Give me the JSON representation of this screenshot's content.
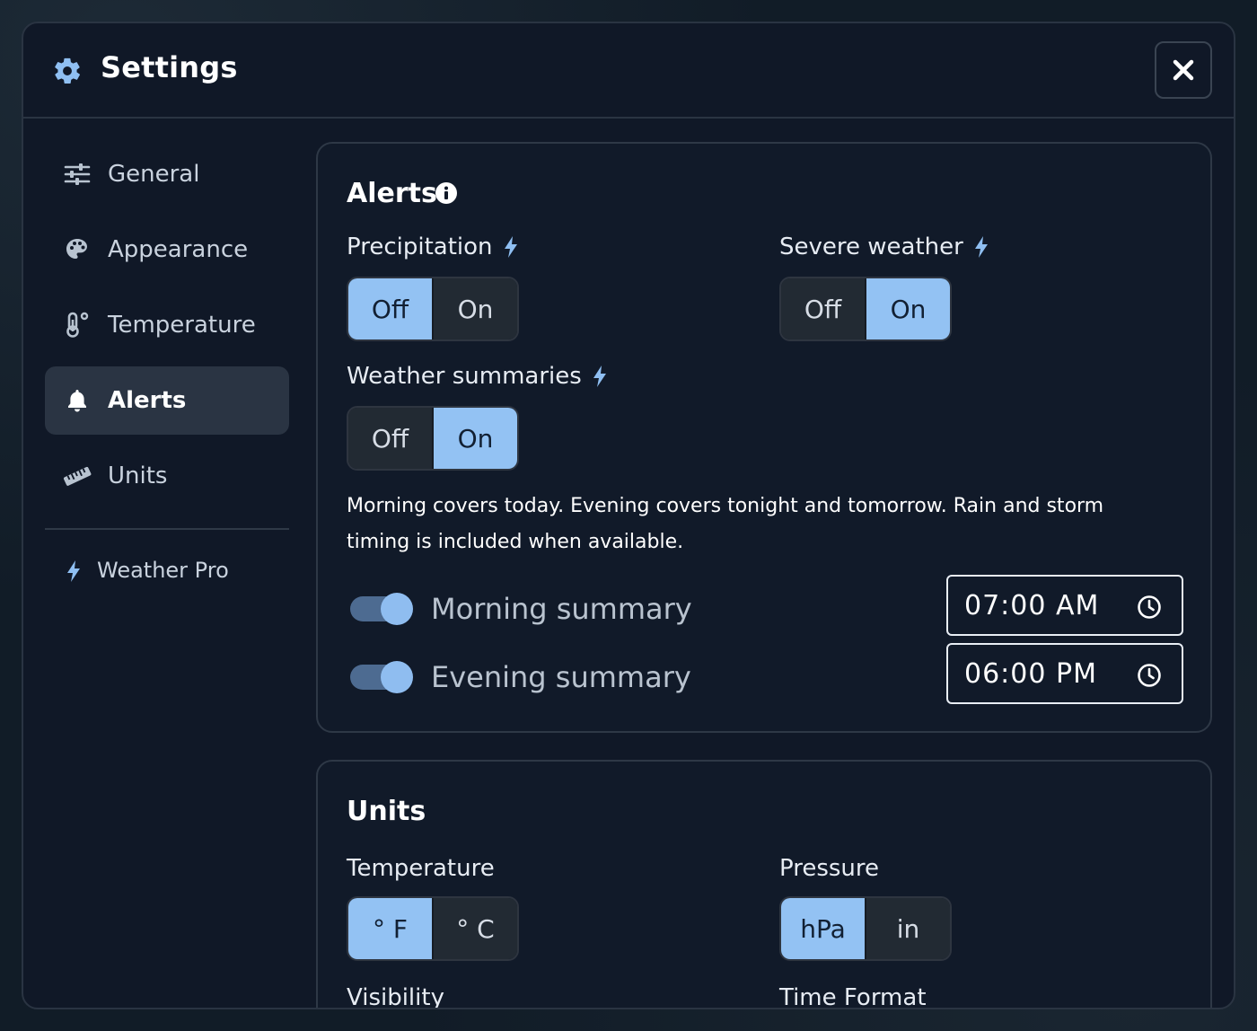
{
  "header": {
    "title": "Settings"
  },
  "sidebar": {
    "items": [
      {
        "label": "General",
        "icon": "sliders-icon",
        "active": false
      },
      {
        "label": "Appearance",
        "icon": "palette-icon",
        "active": false
      },
      {
        "label": "Temperature",
        "icon": "thermometer-icon",
        "active": false
      },
      {
        "label": "Alerts",
        "icon": "bell-icon",
        "active": true
      },
      {
        "label": "Units",
        "icon": "ruler-icon",
        "active": false
      }
    ],
    "pro": {
      "label": "Weather Pro",
      "icon": "bolt-icon"
    }
  },
  "alerts": {
    "title": "Alerts",
    "precipitation": {
      "label": "Precipitation",
      "off": "Off",
      "on": "On",
      "selected": "Off"
    },
    "severe": {
      "label": "Severe weather",
      "off": "Off",
      "on": "On",
      "selected": "On"
    },
    "summaries": {
      "label": "Weather summaries",
      "off": "Off",
      "on": "On",
      "selected": "On"
    },
    "description": "Morning covers today. Evening covers tonight and tomorrow. Rain and storm timing is included when available.",
    "morning": {
      "label": "Morning summary",
      "enabled": true,
      "time": "07:00 AM"
    },
    "evening": {
      "label": "Evening summary",
      "enabled": true,
      "time": "06:00 PM"
    }
  },
  "units": {
    "title": "Units",
    "temperature": {
      "label": "Temperature",
      "opt1": "° F",
      "opt2": "° C",
      "selected": "° F"
    },
    "pressure": {
      "label": "Pressure",
      "opt1": "hPa",
      "opt2": "in",
      "selected": "hPa"
    },
    "visibility": {
      "label": "Visibility"
    },
    "time_format": {
      "label": "Time Format"
    }
  },
  "colors": {
    "accent": "#93c2f3",
    "accent_bolt": "#8fbff2",
    "panel_bg": "#111a29",
    "segment_off_bg": "#222a33"
  }
}
